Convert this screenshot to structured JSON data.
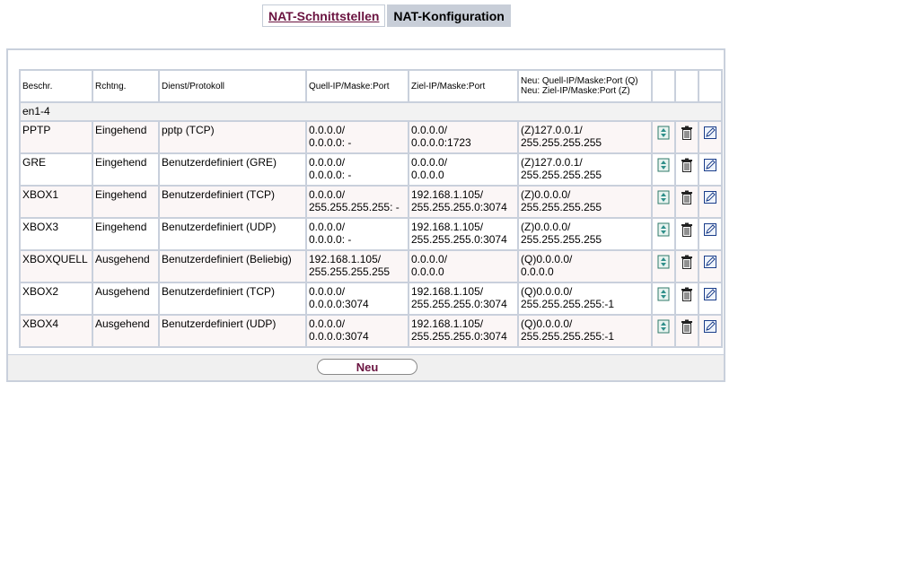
{
  "tabs": [
    {
      "label": "NAT-Schnittstellen",
      "active": false
    },
    {
      "label": "NAT-Konfiguration",
      "active": true
    }
  ],
  "table": {
    "headers": {
      "beschr": "Beschr.",
      "rchtng": "Rchtng.",
      "dienst": "Dienst/Protokoll",
      "quell": "Quell-IP/Maske:Port",
      "ziel": "Ziel-IP/Maske:Port",
      "neu_line1": "Neu: Quell-IP/Maske:Port (Q)",
      "neu_line2": "Neu: Ziel-IP/Maske:Port (Z)"
    },
    "group_label": "en1-4",
    "rows": [
      {
        "beschr": "PPTP",
        "rchtng": "Eingehend",
        "dienst": "pptp (TCP)",
        "quell1": "0.0.0.0/",
        "quell2": "0.0.0.0: -",
        "ziel1": "0.0.0.0/",
        "ziel2": "0.0.0.0:1723",
        "neu1": "(Z)127.0.0.1/",
        "neu2": "255.255.255.255"
      },
      {
        "beschr": "GRE",
        "rchtng": "Eingehend",
        "dienst": "Benutzerdefiniert (GRE)",
        "quell1": "0.0.0.0/",
        "quell2": "0.0.0.0: -",
        "ziel1": "0.0.0.0/",
        "ziel2": "0.0.0.0",
        "neu1": "(Z)127.0.0.1/",
        "neu2": "255.255.255.255"
      },
      {
        "beschr": "XBOX1",
        "rchtng": "Eingehend",
        "dienst": "Benutzerdefiniert (TCP)",
        "quell1": "0.0.0.0/",
        "quell2": "255.255.255.255: -",
        "ziel1": "192.168.1.105/",
        "ziel2": "255.255.255.0:3074",
        "neu1": "(Z)0.0.0.0/",
        "neu2": "255.255.255.255"
      },
      {
        "beschr": "XBOX3",
        "rchtng": "Eingehend",
        "dienst": "Benutzerdefiniert (UDP)",
        "quell1": "0.0.0.0/",
        "quell2": "0.0.0.0: -",
        "ziel1": "192.168.1.105/",
        "ziel2": "255.255.255.0:3074",
        "neu1": "(Z)0.0.0.0/",
        "neu2": "255.255.255.255"
      },
      {
        "beschr": "XBOXQUELL",
        "rchtng": "Ausgehend",
        "dienst": "Benutzerdefiniert (Beliebig)",
        "quell1": "192.168.1.105/",
        "quell2": "255.255.255.255",
        "ziel1": "0.0.0.0/",
        "ziel2": "0.0.0.0",
        "neu1": "(Q)0.0.0.0/",
        "neu2": "0.0.0.0"
      },
      {
        "beschr": "XBOX2",
        "rchtng": "Ausgehend",
        "dienst": "Benutzerdefiniert (TCP)",
        "quell1": "0.0.0.0/",
        "quell2": "0.0.0.0:3074",
        "ziel1": "192.168.1.105/",
        "ziel2": "255.255.255.0:3074",
        "neu1": "(Q)0.0.0.0/",
        "neu2": "255.255.255.255:-1"
      },
      {
        "beschr": "XBOX4",
        "rchtng": "Ausgehend",
        "dienst": "Benutzerdefiniert (UDP)",
        "quell1": "0.0.0.0/",
        "quell2": "0.0.0.0:3074",
        "ziel1": "192.168.1.105/",
        "ziel2": "255.255.255.0:3074",
        "neu1": "(Q)0.0.0.0/",
        "neu2": "255.255.255.255:-1"
      }
    ]
  },
  "actions": {
    "icons": [
      "move-up-down-icon",
      "trash-icon",
      "edit-icon"
    ],
    "new_button": "Neu"
  },
  "colors": {
    "accent": "#6a1340",
    "border": "#c9d0dc",
    "active_tab": "#c8ced8"
  }
}
